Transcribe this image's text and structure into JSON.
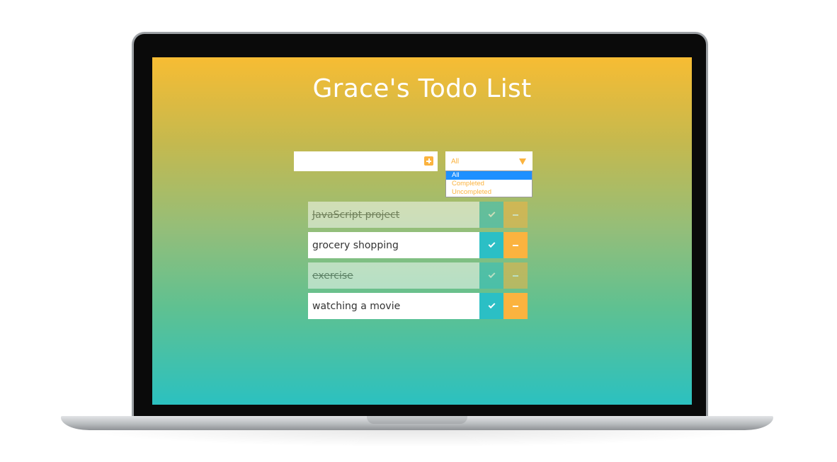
{
  "app": {
    "title": "Grace's Todo List"
  },
  "input": {
    "value": "",
    "placeholder": ""
  },
  "filter": {
    "selected": "All",
    "options": [
      "All",
      "Completed",
      "Uncompleted"
    ]
  },
  "todos": [
    {
      "text": "JavaScript project",
      "completed": true
    },
    {
      "text": "grocery shopping",
      "completed": false
    },
    {
      "text": "exercise",
      "completed": true
    },
    {
      "text": "watching a movie",
      "completed": false
    }
  ],
  "colors": {
    "accent_orange": "#fbb33f",
    "accent_teal": "#2bbfc5",
    "gradient_top": "#f7bc33",
    "gradient_bottom": "#2bc1c0",
    "selected_option": "#1e90ff"
  },
  "icons": {
    "add": "plus-square-icon",
    "filter_dropdown": "caret-down-icon",
    "complete": "check-icon",
    "delete": "minus-icon"
  }
}
